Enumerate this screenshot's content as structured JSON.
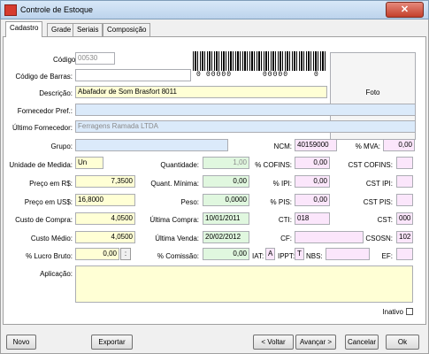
{
  "window": {
    "title": "Controle de Estoque",
    "close": "✕"
  },
  "tabs": [
    "Cadastro",
    "Grade",
    "Seriais",
    "Composição"
  ],
  "labels": {
    "codigo": "Código:",
    "codigo_barras": "Código de Barras:",
    "descricao": "Descrição:",
    "fornecedor_pref": "Fornecedor Pref.:",
    "ultimo_fornecedor": "Último Fornecedor:",
    "grupo": "Grupo:",
    "unidade": "Unidade de Medida:",
    "preco_rs": "Preço em R$:",
    "preco_us": "Preço em US$:",
    "custo_compra": "Custo de Compra:",
    "custo_medio": "Custo Médio:",
    "lucro_bruto": "% Lucro Bruto:",
    "aplicacao": "Aplicação:",
    "quantidade": "Quantidade:",
    "quant_minima": "Quant. Mínima:",
    "peso": "Peso:",
    "ultima_compra": "Última Compra:",
    "ultima_venda": "Última Venda:",
    "comissao": "% Comissão:",
    "ncm": "NCM:",
    "cofins": "% COFINS:",
    "ipi": "% IPI:",
    "pis": "% PIS:",
    "cti": "CTI:",
    "cf": "CF:",
    "iat": "IAT:",
    "ippt": "IPPT:",
    "nbs": "NBS:",
    "mva": "% MVA:",
    "cst_cofins": "CST COFINS:",
    "cst_ipi": "CST IPI:",
    "cst_pis": "CST PIS:",
    "cst": "CST:",
    "csosn": "CSOSN:",
    "ef": "EF:",
    "foto": "Foto",
    "inativo": "Inativo"
  },
  "values": {
    "codigo": "00530",
    "codigo_barras": "",
    "barcode_digits": [
      "0",
      "00000",
      "00000",
      "0"
    ],
    "descricao": "Abafador de Som Brasfort 8011",
    "fornecedor_pref": "",
    "ultimo_fornecedor": "Ferragens Ramada LTDA",
    "grupo": "",
    "unidade": "Un",
    "preco_rs": "7,3500",
    "preco_us": "16,8000",
    "custo_compra": "4,0500",
    "custo_medio": "4,0500",
    "lucro_bruto": "0,00",
    "spin": ":",
    "aplicacao": "",
    "quantidade": "1,00",
    "quant_minima": "0,00",
    "peso": "0,0000",
    "ultima_compra": "10/01/2011",
    "ultima_venda": "20/02/2012",
    "comissao": "0,00",
    "ncm": "40159000",
    "cofins": "0,00",
    "ipi": "0,00",
    "pis": "0,00",
    "cti": "018",
    "cf": "",
    "iat": "A",
    "ippt": "T",
    "nbs": "",
    "mva": "0,00",
    "cst_cofins": "",
    "cst_ipi": "",
    "cst_pis": "",
    "cst": "000",
    "csosn": "102",
    "ef": ""
  },
  "buttons": {
    "novo": "Novo",
    "exportar": "Exportar",
    "voltar": "< Voltar",
    "avancar": "Avançar >",
    "cancelar": "Cancelar",
    "ok": "Ok"
  },
  "colors": {
    "yellow_field": "#ffffd5",
    "blue_field": "#dbeafa",
    "green_field": "#e0f7df",
    "pink_field": "#fbe6fb",
    "close_button": "#c4402c"
  }
}
